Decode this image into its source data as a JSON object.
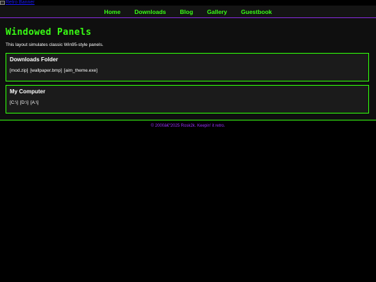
{
  "banner": {
    "alt_text": "Retro Banner"
  },
  "nav": {
    "items": [
      "Home",
      "Downloads",
      "Blog",
      "Gallery",
      "Guestbook"
    ]
  },
  "page": {
    "title": "Windowed Panels",
    "intro": "This layout simulates classic Win95-style panels."
  },
  "panels": [
    {
      "title": "Downloads Folder",
      "items": [
        "[mod.zip]",
        "[wallpaper.bmp]",
        "[aim_theme.exe]"
      ]
    },
    {
      "title": "My Computer",
      "items": [
        "[C:\\]",
        "[D:\\]",
        "[A:\\]"
      ]
    }
  ],
  "footer": {
    "text": "© 2000â€“2025 Rosk2k. Keepin' it retro."
  },
  "colors": {
    "accent_green": "#39ff14",
    "accent_purple": "#9b30ff",
    "background": "#000000"
  }
}
